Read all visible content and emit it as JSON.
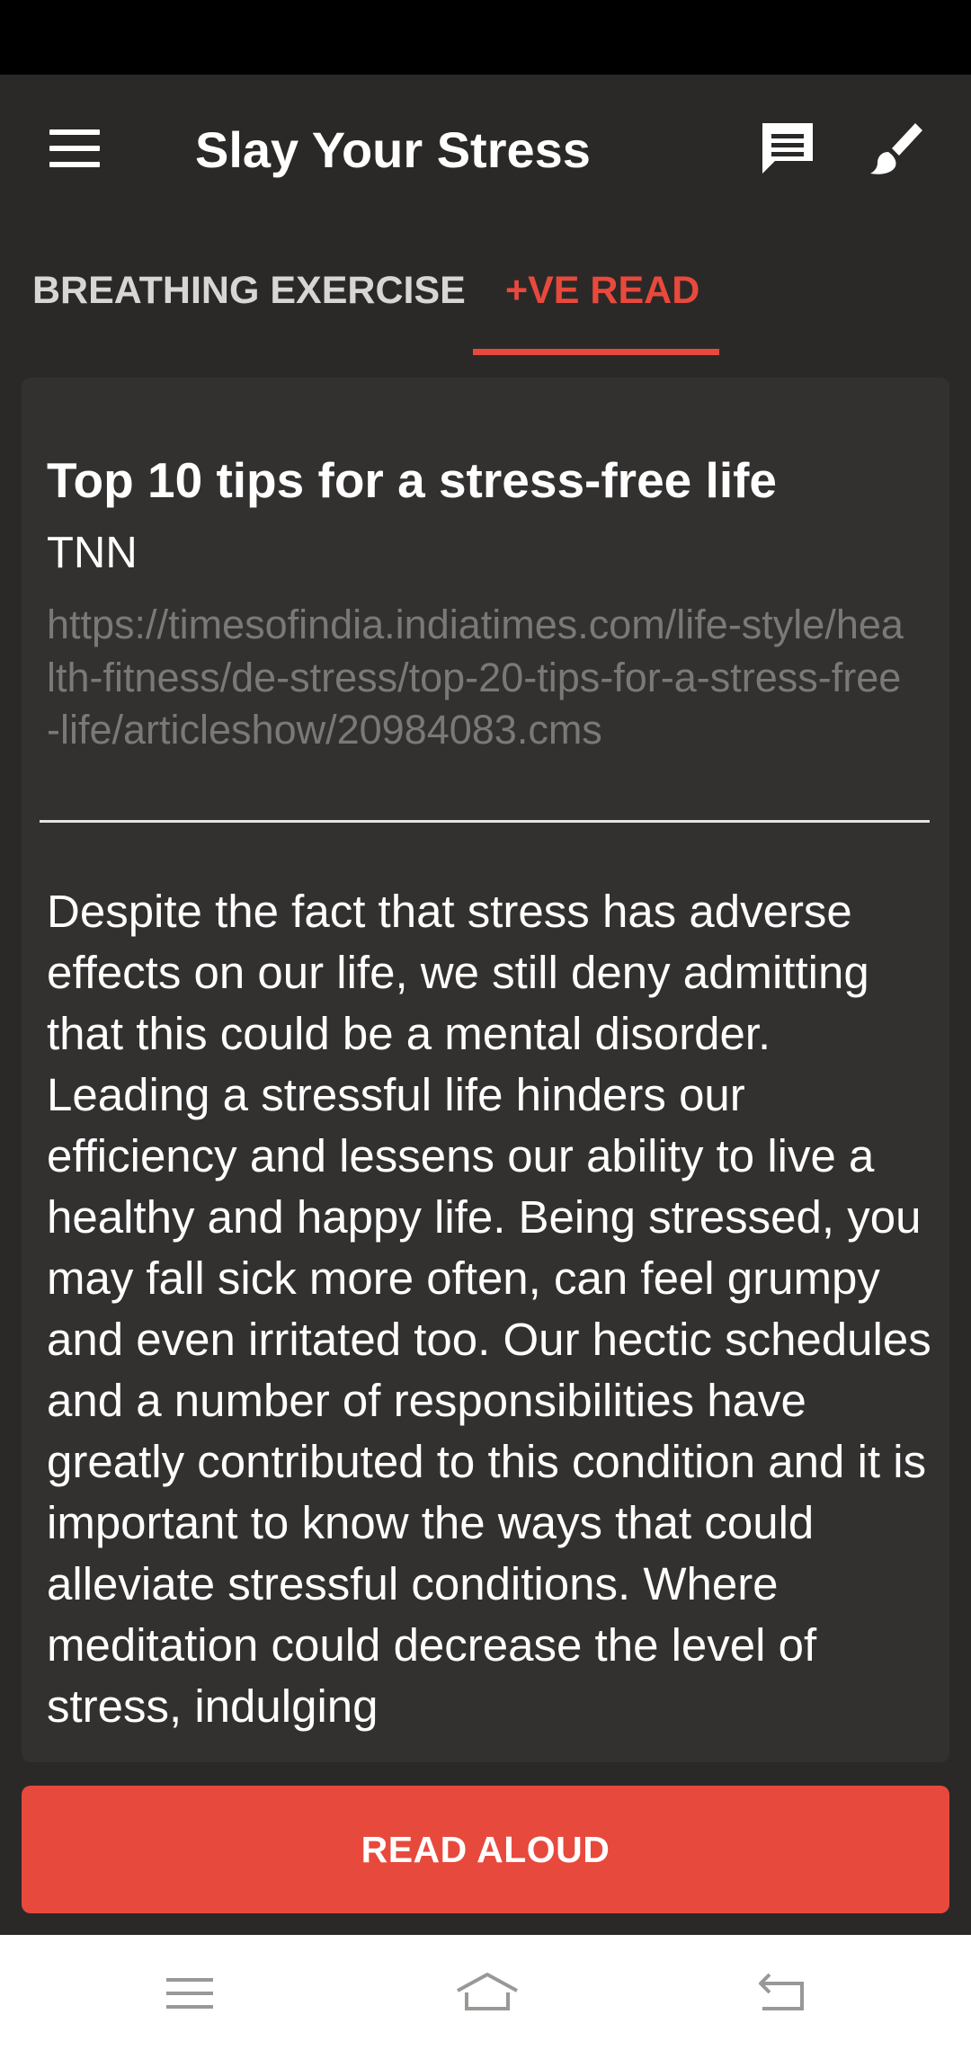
{
  "app": {
    "title": "Slay Your Stress"
  },
  "icons": {
    "menu": "hamburger-menu-icon",
    "chat": "chat-icon",
    "brush": "brush-icon"
  },
  "tabs": [
    {
      "label": "BREATHING EXERCISE",
      "selected": false
    },
    {
      "label": "+VE READ",
      "selected": true
    }
  ],
  "article": {
    "title": "Top 10 tips for a stress-free life",
    "author": "TNN",
    "url": "https://timesofindia.indiatimes.com/life-style/health-fitness/de-stress/top-20-tips-for-a-stress-free-life/articleshow/20984083.cms",
    "body": "Despite the fact that stress has adverse effects on our life, we still deny admitting that this could be a mental disorder. Leading a stressful life hinders our efficiency and lessens our ability to live a healthy and happy life. Being stressed, you may fall sick more often, can feel grumpy and even irritated too. Our hectic schedules and a number of responsibilities have greatly contributed to this condition and it is important to know the ways that could alleviate stressful conditions. Where meditation could decrease the level of stress, indulging"
  },
  "actions": {
    "read_aloud": "READ ALOUD"
  },
  "colors": {
    "accent": "#e8493d",
    "background": "#2b2927",
    "card": "#333130"
  }
}
